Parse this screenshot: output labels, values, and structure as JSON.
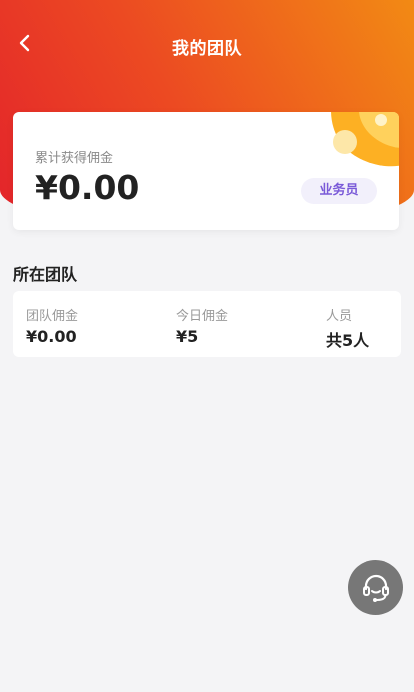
{
  "header": {
    "title": "我的团队",
    "back_icon": "chevron-left-icon",
    "gradient": [
      "#e3232b",
      "#ec4a22",
      "#f28a14"
    ]
  },
  "summary": {
    "label": "累计获得佣金",
    "amount": "¥0.00",
    "role_badge": "业务员"
  },
  "team_section": {
    "title": "所在团队",
    "stats": [
      {
        "label": "团队佣金",
        "value": "¥0.00"
      },
      {
        "label": "今日佣金",
        "value": "¥5"
      },
      {
        "label": "人员",
        "value": "共5人"
      }
    ]
  },
  "floating": {
    "icon": "headset-icon",
    "background": "#777777"
  }
}
